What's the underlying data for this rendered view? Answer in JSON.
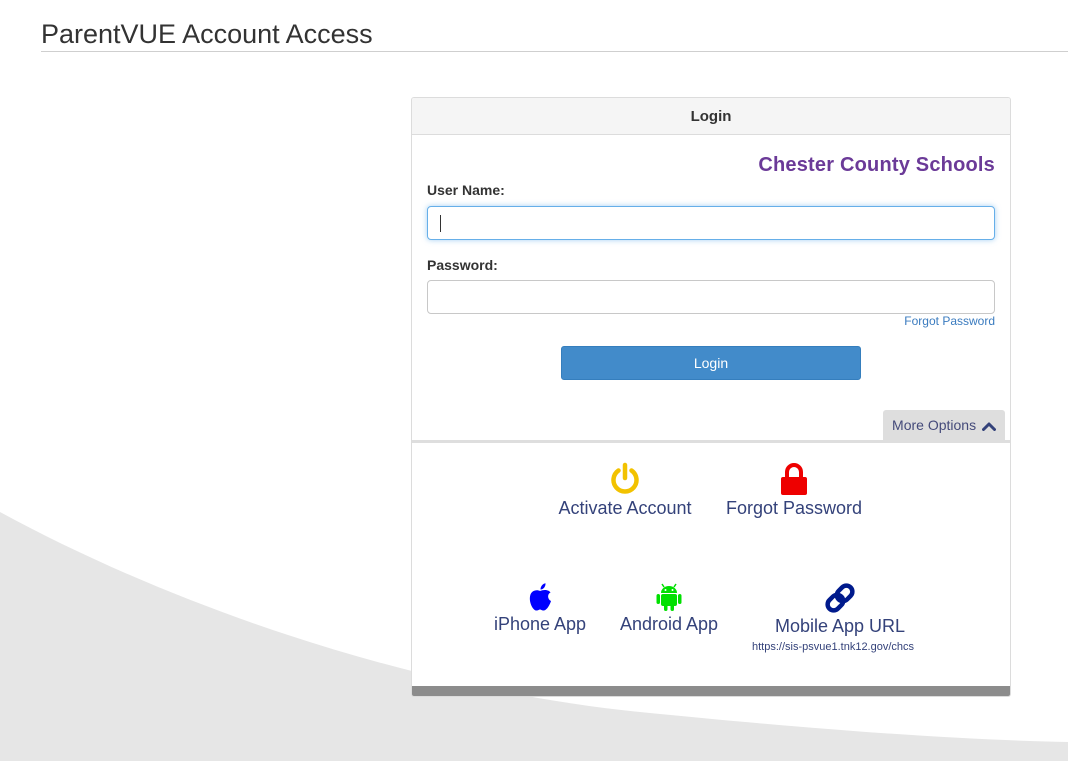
{
  "page": {
    "title": "ParentVUE Account Access"
  },
  "panel": {
    "heading": "Login",
    "district": "Chester County Schools"
  },
  "form": {
    "username_label": "User Name:",
    "username_value": "",
    "password_label": "Password:",
    "password_value": "",
    "forgot_password_link": "Forgot Password",
    "login_button": "Login"
  },
  "more_options": {
    "label": "More Options",
    "icon": "chevron-up-icon"
  },
  "options": {
    "activate": {
      "label": "Activate Account",
      "icon": "power-icon",
      "color": "#f2c200"
    },
    "forgot": {
      "label": "Forgot Password",
      "icon": "lock-icon",
      "color": "#ee0000"
    },
    "iphone": {
      "label": "iPhone App",
      "icon": "apple-icon",
      "color": "#0000ff"
    },
    "android": {
      "label": "Android App",
      "icon": "android-icon",
      "color": "#00e000"
    },
    "mobile_url": {
      "label": "Mobile App URL",
      "icon": "link-icon",
      "color": "#001a8c",
      "url": "https://sis-psvue1.tnk12.gov/chcs"
    }
  },
  "colors": {
    "accent": "#428bca",
    "district": "#6b3a98",
    "option_text": "#34427a"
  }
}
